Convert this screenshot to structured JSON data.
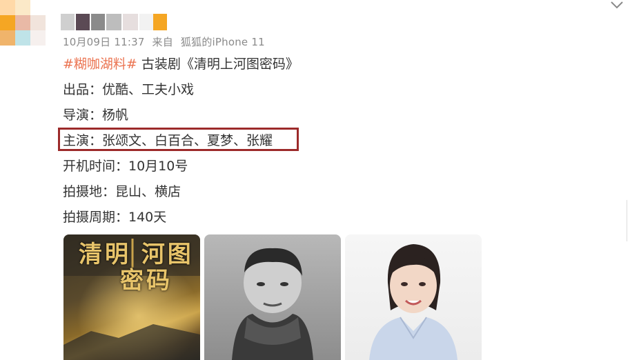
{
  "post": {
    "date": "10月09日 11:37",
    "source_prefix": "来自",
    "source_device": "狐狐的iPhone 11",
    "hashtag": "#糊咖湖料#",
    "title": " 古装剧《清明上河图密码》",
    "lines": [
      "出品：优酷、工夫小戏",
      "导演：杨帆",
      "主演：张颂文、白百合、夏梦、张耀",
      "开机时间：10月10号",
      "拍摄地：昆山、横店",
      "拍摄周期：140天"
    ]
  },
  "images": [
    {
      "name": "drama-poster",
      "text": "清明上河图密码"
    },
    {
      "name": "actor-photo-man"
    },
    {
      "name": "actress-photo-woman"
    }
  ],
  "colors": {
    "hashtag": "#eb7350",
    "highlight_border": "#9c2a2a",
    "meta_text": "#8a8a8a"
  }
}
